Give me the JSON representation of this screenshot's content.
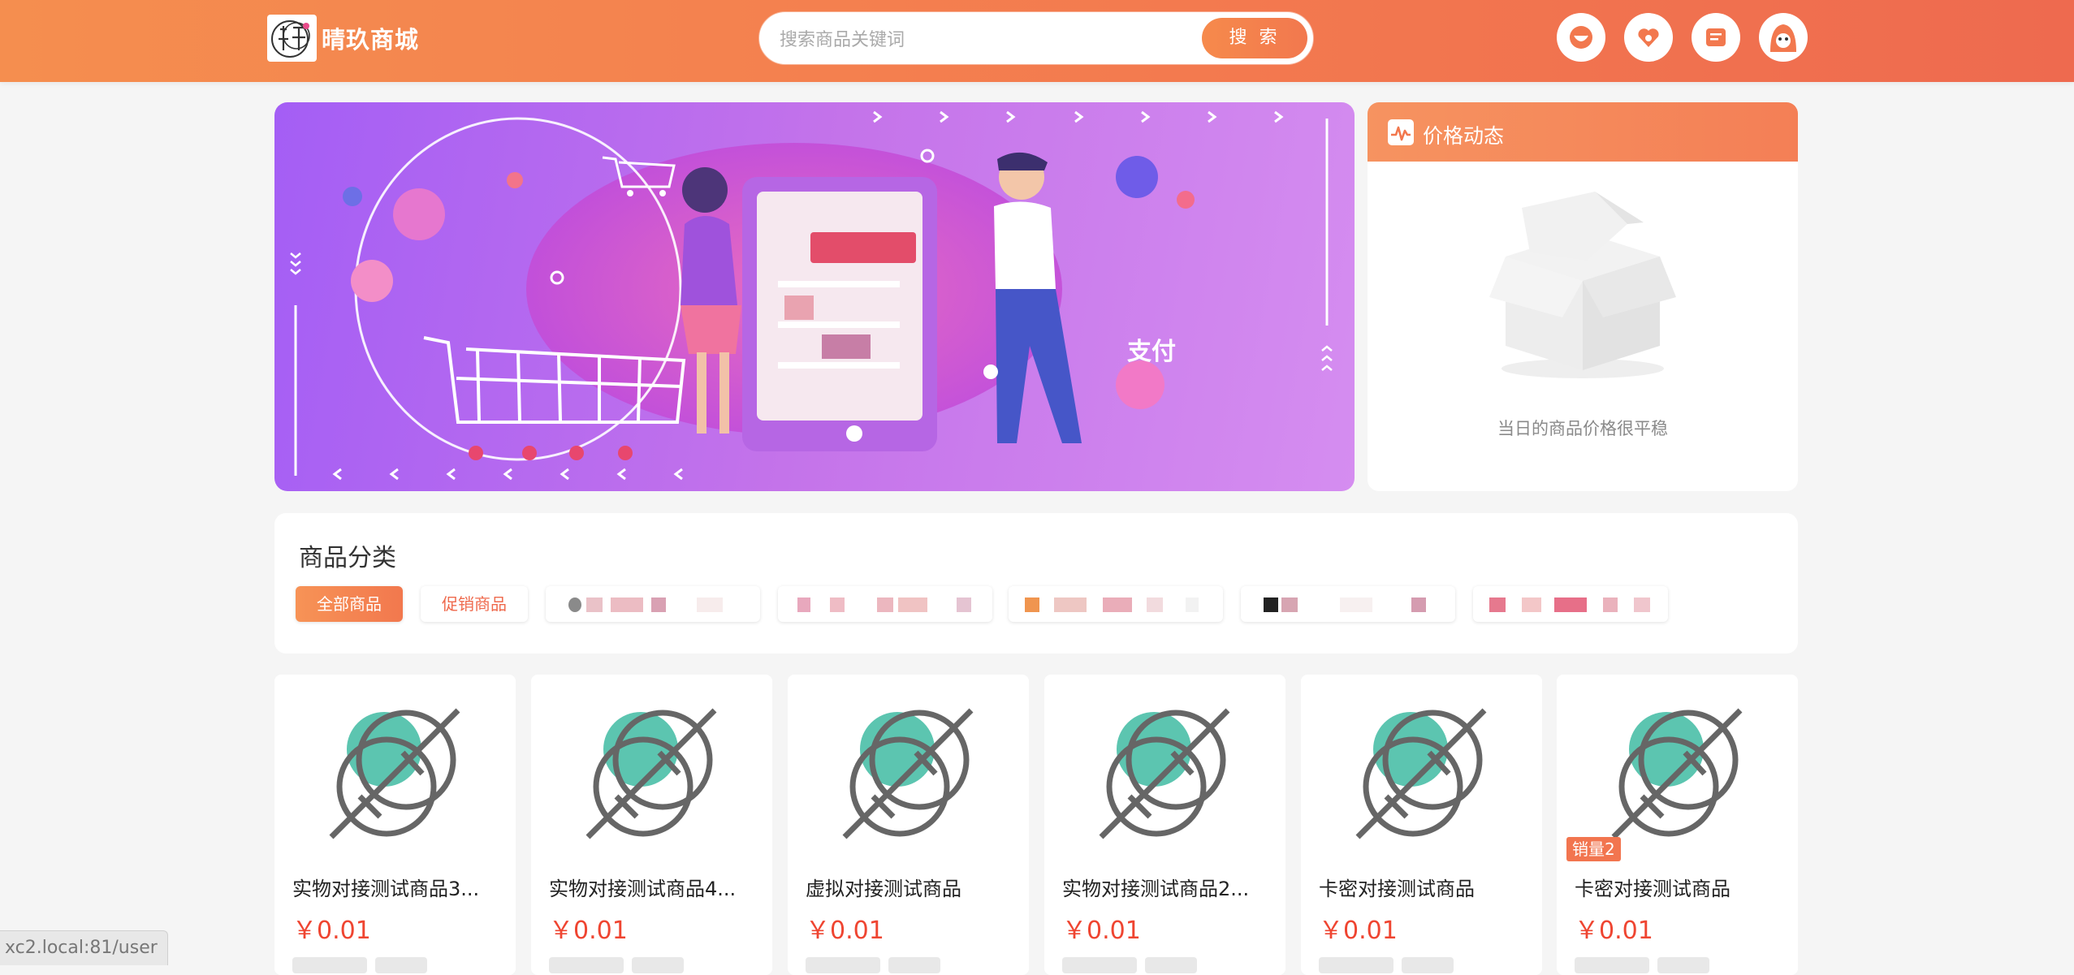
{
  "header": {
    "brand": "晴玖商城",
    "search_placeholder": "搜索商品关键词",
    "search_button": "搜 索",
    "icons": [
      "orders-icon",
      "favorites-icon",
      "cart-icon",
      "user-avatar-icon"
    ]
  },
  "banner": {
    "caption": "支付"
  },
  "price_panel": {
    "title": "价格动态",
    "empty_text": "当日的商品价格很平稳"
  },
  "category": {
    "title": "商品分类",
    "tabs": [
      "全部商品",
      "促销商品"
    ],
    "blurred_tab_count": 5
  },
  "products": [
    {
      "name": "实物对接测试商品3...",
      "price": "￥0.01",
      "badge": ""
    },
    {
      "name": "实物对接测试商品4...",
      "price": "￥0.01",
      "badge": ""
    },
    {
      "name": "虚拟对接测试商品",
      "price": "￥0.01",
      "badge": ""
    },
    {
      "name": "实物对接测试商品2...",
      "price": "￥0.01",
      "badge": ""
    },
    {
      "name": "卡密对接测试商品",
      "price": "￥0.01",
      "badge": ""
    },
    {
      "name": "卡密对接测试商品",
      "price": "￥0.01",
      "badge": "销量2"
    }
  ],
  "status_bar": {
    "url": "xc2.local:81/user"
  },
  "colors": {
    "brand_orange": "#f3794f",
    "price_red": "#ef4531",
    "banner_purple": "#a45ef5",
    "placeholder_teal": "#5cc5b0"
  }
}
